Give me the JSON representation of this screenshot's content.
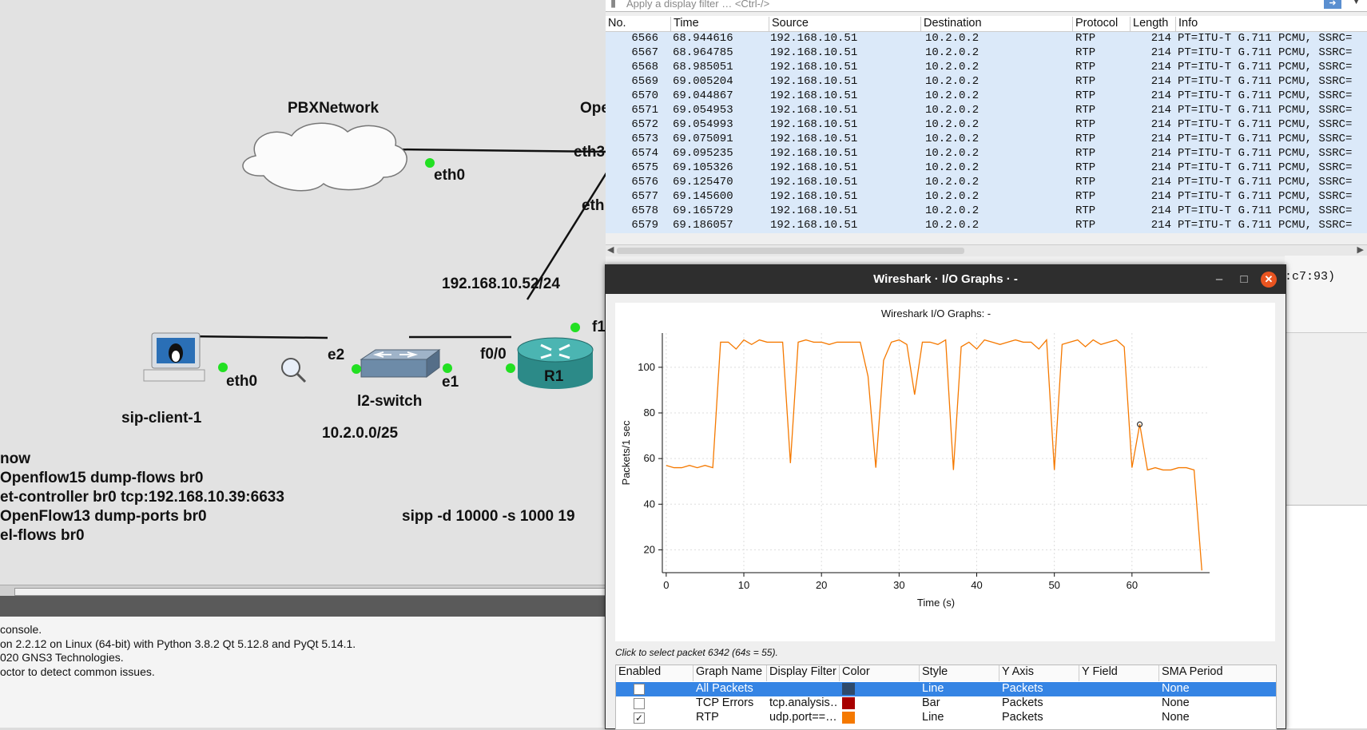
{
  "topology": {
    "cloud_label": "PBXNetwork",
    "cloud_port": "eth0",
    "ovs_partial_label": "Ope",
    "ovs_port_a": "eth3",
    "ovs_port_b": "eth",
    "r1_network": "192.168.10.52/24",
    "r1_port_f1": "f1",
    "r1_label": "R1",
    "r1_port_f00": "f0/0",
    "switch_label": "l2-switch",
    "switch_port_e1": "e1",
    "switch_port_e2": "e2",
    "client_label": "sip-client-1",
    "client_port": "eth0",
    "lan_network": "10.2.0.0/25",
    "commands": [
      "now",
      "  Openflow15 dump-flows br0",
      "et-controller br0 tcp:192.168.10.39:6633",
      "  OpenFlow13 dump-ports br0",
      "el-flows br0"
    ],
    "sipp_cmd": "sipp -d 10000 -s 1000 19"
  },
  "console": {
    "lines": [
      "console.",
      "on 2.2.12 on Linux (64-bit) with Python 3.8.2 Qt 5.12.8 and PyQt 5.14.1.",
      "020 GNS3 Technologies.",
      "octor to detect common issues."
    ]
  },
  "wireshark": {
    "filter_placeholder": "Apply a display filter … <Ctrl-/>",
    "columns": [
      "No.",
      "Time",
      "Source",
      "Destination",
      "Protocol",
      "Length",
      "Info"
    ],
    "packets": [
      {
        "no": "6566",
        "time": "68.944616",
        "src": "192.168.10.51",
        "dst": "10.2.0.2",
        "proto": "RTP",
        "len": "214",
        "info": "PT=ITU-T G.711 PCMU, SSRC="
      },
      {
        "no": "6567",
        "time": "68.964785",
        "src": "192.168.10.51",
        "dst": "10.2.0.2",
        "proto": "RTP",
        "len": "214",
        "info": "PT=ITU-T G.711 PCMU, SSRC="
      },
      {
        "no": "6568",
        "time": "68.985051",
        "src": "192.168.10.51",
        "dst": "10.2.0.2",
        "proto": "RTP",
        "len": "214",
        "info": "PT=ITU-T G.711 PCMU, SSRC="
      },
      {
        "no": "6569",
        "time": "69.005204",
        "src": "192.168.10.51",
        "dst": "10.2.0.2",
        "proto": "RTP",
        "len": "214",
        "info": "PT=ITU-T G.711 PCMU, SSRC="
      },
      {
        "no": "6570",
        "time": "69.044867",
        "src": "192.168.10.51",
        "dst": "10.2.0.2",
        "proto": "RTP",
        "len": "214",
        "info": "PT=ITU-T G.711 PCMU, SSRC="
      },
      {
        "no": "6571",
        "time": "69.054953",
        "src": "192.168.10.51",
        "dst": "10.2.0.2",
        "proto": "RTP",
        "len": "214",
        "info": "PT=ITU-T G.711 PCMU, SSRC="
      },
      {
        "no": "6572",
        "time": "69.054993",
        "src": "192.168.10.51",
        "dst": "10.2.0.2",
        "proto": "RTP",
        "len": "214",
        "info": "PT=ITU-T G.711 PCMU, SSRC="
      },
      {
        "no": "6573",
        "time": "69.075091",
        "src": "192.168.10.51",
        "dst": "10.2.0.2",
        "proto": "RTP",
        "len": "214",
        "info": "PT=ITU-T G.711 PCMU, SSRC="
      },
      {
        "no": "6574",
        "time": "69.095235",
        "src": "192.168.10.51",
        "dst": "10.2.0.2",
        "proto": "RTP",
        "len": "214",
        "info": "PT=ITU-T G.711 PCMU, SSRC="
      },
      {
        "no": "6575",
        "time": "69.105326",
        "src": "192.168.10.51",
        "dst": "10.2.0.2",
        "proto": "RTP",
        "len": "214",
        "info": "PT=ITU-T G.711 PCMU, SSRC="
      },
      {
        "no": "6576",
        "time": "69.125470",
        "src": "192.168.10.51",
        "dst": "10.2.0.2",
        "proto": "RTP",
        "len": "214",
        "info": "PT=ITU-T G.711 PCMU, SSRC="
      },
      {
        "no": "6577",
        "time": "69.145600",
        "src": "192.168.10.51",
        "dst": "10.2.0.2",
        "proto": "RTP",
        "len": "214",
        "info": "PT=ITU-T G.711 PCMU, SSRC="
      },
      {
        "no": "6578",
        "time": "69.165729",
        "src": "192.168.10.51",
        "dst": "10.2.0.2",
        "proto": "RTP",
        "len": "214",
        "info": "PT=ITU-T G.711 PCMU, SSRC="
      },
      {
        "no": "6579",
        "time": "69.186057",
        "src": "192.168.10.51",
        "dst": "10.2.0.2",
        "proto": "RTP",
        "len": "214",
        "info": "PT=ITU-T G.711 PCMU, SSRC="
      }
    ],
    "detail_peek": ":c7:93)",
    "row_bg": "#dbe9f9"
  },
  "io_window": {
    "title": "Wireshark · I/O Graphs · -",
    "hint": "Click to select packet 6342 (64s = 55).",
    "table_headers": [
      "Enabled",
      "Graph Name",
      "Display Filter",
      "Color",
      "Style",
      "Y Axis",
      "Y Field",
      "SMA Period"
    ],
    "graphs": [
      {
        "enabled": "",
        "name": "All Packets",
        "filter": "",
        "color": "#2e4a6b",
        "style": "Line",
        "yaxis": "Packets",
        "yfield": "",
        "sma": "None",
        "selected": true
      },
      {
        "enabled": "",
        "name": "TCP Errors",
        "filter": "tcp.analysis…",
        "color": "#a80000",
        "style": "Bar",
        "yaxis": "Packets",
        "yfield": "",
        "sma": "None",
        "selected": false
      },
      {
        "enabled": "✓",
        "name": "RTP",
        "filter": "udp.port==…",
        "color": "#f57900",
        "style": "Line",
        "yaxis": "Packets",
        "yfield": "",
        "sma": "None",
        "selected": false
      }
    ]
  },
  "chart_data": {
    "type": "line",
    "title": "Wireshark I/O Graphs: -",
    "xlabel": "Time (s)",
    "ylabel": "Packets/1 sec",
    "xlim": [
      -0.5,
      70
    ],
    "ylim": [
      10,
      115
    ],
    "xticks": [
      0,
      10,
      20,
      30,
      40,
      50,
      60
    ],
    "yticks": [
      20,
      40,
      60,
      80,
      100
    ],
    "grid": true,
    "line_color": "#f57900",
    "series": [
      {
        "x": [
          0,
          1,
          2,
          3,
          4,
          5,
          6,
          7,
          8,
          9,
          10,
          11,
          12,
          13,
          14,
          15,
          16,
          17,
          18,
          19,
          20,
          21,
          22,
          23,
          24,
          25,
          26,
          27,
          28,
          29,
          30,
          31,
          32,
          33,
          34,
          35,
          36,
          37,
          38,
          39,
          40,
          41,
          42,
          43,
          44,
          45,
          46,
          47,
          48,
          49,
          50,
          51,
          52,
          53,
          54,
          55,
          56,
          57,
          58,
          59,
          60,
          61,
          62,
          63,
          64,
          65,
          66,
          67,
          68,
          69
        ],
        "y": [
          57,
          56,
          56,
          57,
          56,
          57,
          56,
          111,
          111,
          108,
          112,
          110,
          112,
          111,
          111,
          111,
          58,
          111,
          112,
          111,
          111,
          110,
          111,
          111,
          111,
          111,
          96,
          56,
          103,
          111,
          112,
          110,
          88,
          111,
          111,
          110,
          112,
          55,
          109,
          111,
          108,
          112,
          111,
          110,
          111,
          112,
          111,
          111,
          108,
          112,
          55,
          110,
          111,
          112,
          109,
          112,
          110,
          111,
          112,
          109,
          56,
          75,
          55,
          56,
          55,
          55,
          56,
          56,
          55,
          11
        ]
      }
    ],
    "marker": {
      "x": 61,
      "y": 75
    }
  }
}
